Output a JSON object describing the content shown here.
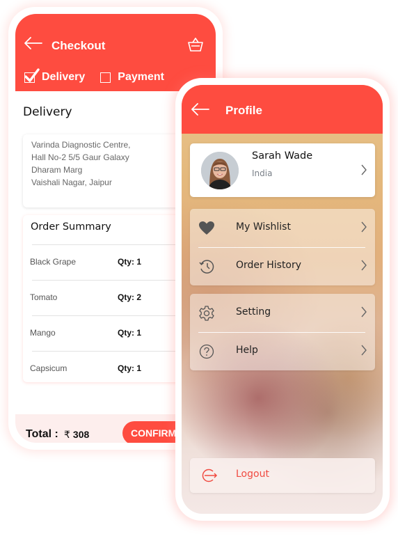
{
  "colors": {
    "brand": "#fe4c40",
    "footer_bg": "#fdeeed",
    "logout_text": "#f04a40"
  },
  "checkout": {
    "title": "Checkout",
    "back_icon": "arrow-left-icon",
    "cart_icon": "basket-icon",
    "steps": [
      {
        "label": "Delivery",
        "checked": true
      },
      {
        "label": "Payment",
        "checked": false
      }
    ],
    "section_title": "Delivery",
    "address": [
      "Varinda Diagnostic Centre,",
      "Hall No-2 5/5 Gaur Galaxy",
      "Dharam Marg",
      "Vaishali Nagar, Jaipur"
    ],
    "order_summary": {
      "title": "Order Summary",
      "items": [
        {
          "name": "Black Grape",
          "qty": "Qty: 1"
        },
        {
          "name": "Tomato",
          "qty": "Qty: 2"
        },
        {
          "name": "Mango",
          "qty": "Qty: 1"
        },
        {
          "name": "Capsicum",
          "qty": "Qty: 1"
        }
      ]
    },
    "footer": {
      "total_label": "Total :",
      "currency_symbol": "₹",
      "total_value": "308",
      "confirm_label": "CONFIRM P"
    }
  },
  "profile": {
    "title": "Profile",
    "back_icon": "arrow-left-icon",
    "user": {
      "name": "Sarah Wade",
      "country": "India"
    },
    "menu_groups": [
      [
        {
          "label": "My Wishlist",
          "icon": "heart-icon"
        },
        {
          "label": "Order History",
          "icon": "history-icon"
        }
      ],
      [
        {
          "label": "Setting",
          "icon": "gear-icon"
        },
        {
          "label": "Help",
          "icon": "help-icon"
        }
      ]
    ],
    "logout": {
      "label": "Logout",
      "icon": "logout-icon"
    }
  }
}
